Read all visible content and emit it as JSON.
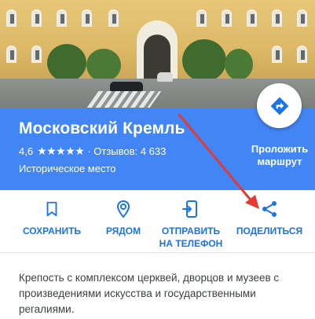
{
  "place": {
    "title": "Московский Кремль",
    "rating": "4,6",
    "stars_value": 4.5,
    "stars_glyphs": "★★★★★",
    "reviews": "· Отзывов: 4 633",
    "category": "Историческое место"
  },
  "directions": {
    "label_line1": "Проложить",
    "label_line2": "маршрут",
    "icon": "directions-icon"
  },
  "actions": [
    {
      "label_line1": "СОХРАНИТЬ",
      "label_line2": "",
      "icon": "bookmark-icon"
    },
    {
      "label_line1": "РЯДОМ",
      "label_line2": "",
      "icon": "nearby-icon"
    },
    {
      "label_line1": "ОТПРАВИТЬ",
      "label_line2": "НА ТЕЛЕФОН",
      "icon": "send-to-phone-icon"
    },
    {
      "label_line1": "ПОДЕЛИТЬСЯ",
      "label_line2": "",
      "icon": "share-icon"
    }
  ],
  "description": "Крепость с комплексом церквей, дворцов и музеев с произведениями искусства и государственными регалиями.",
  "colors": {
    "panel_blue": "#4285f4",
    "action_blue": "#1a73e8",
    "annotation_red": "#e53935"
  }
}
